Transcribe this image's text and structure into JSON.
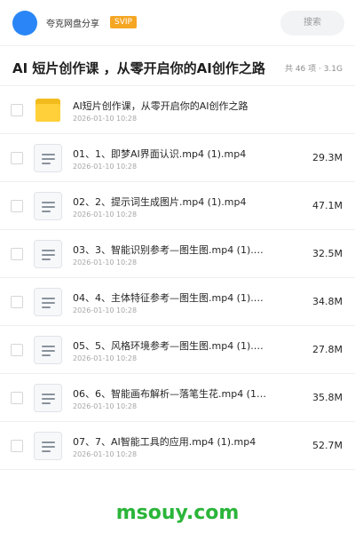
{
  "header": {
    "username": "夸克网盘分享",
    "badge": "SVIP",
    "search_placeholder": "搜索"
  },
  "share": {
    "title": "AI 短片创作课 ，从零开启你的AI创作之路",
    "meta": "共 46 项 · 3.1G"
  },
  "files": [
    {
      "name": "AI短片创作课，从零开启你的AI创作之路",
      "date": "2026-01-10 10:28",
      "size": "",
      "icon": "folder-icon"
    },
    {
      "name": "01、1、即梦AI界面认识.mp4 (1).mp4",
      "date": "2026-01-10 10:28",
      "size": "29.3M",
      "icon": "video-file-icon"
    },
    {
      "name": "02、2、提示词生成图片.mp4 (1).mp4",
      "date": "2026-01-10 10:28",
      "size": "47.1M",
      "icon": "video-file-icon"
    },
    {
      "name": "03、3、智能识别参考—图生图.mp4 (1).m…",
      "date": "2026-01-10 10:28",
      "size": "32.5M",
      "icon": "video-file-icon"
    },
    {
      "name": "04、4、主体特征参考—图生图.mp4 (1).m…",
      "date": "2026-01-10 10:28",
      "size": "34.8M",
      "icon": "video-file-icon"
    },
    {
      "name": "05、5、风格环境参考—图生图.mp4 (1).m…",
      "date": "2026-01-10 10:28",
      "size": "27.8M",
      "icon": "video-file-icon"
    },
    {
      "name": "06、6、智能画布解析—落笔生花.mp4 (1).…",
      "date": "2026-01-10 10:28",
      "size": "35.8M",
      "icon": "video-file-icon"
    },
    {
      "name": "07、7、AI智能工具的应用.mp4 (1).mp4",
      "date": "2026-01-10 10:28",
      "size": "52.7M",
      "icon": "video-file-icon"
    }
  ],
  "watermark": "msouy.com",
  "colors": {
    "avatar": "#2a86f6",
    "badge": "#f5a623",
    "folder": "#ffd03a",
    "watermark": "#2bb53a"
  }
}
